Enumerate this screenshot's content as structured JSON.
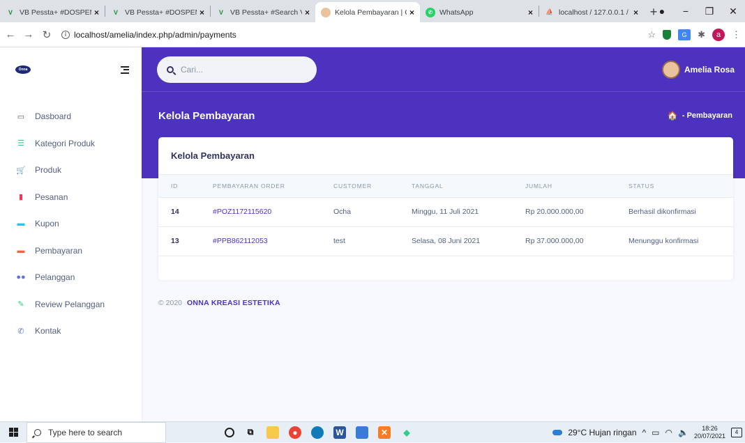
{
  "browser": {
    "tabs": [
      {
        "title": "VB Pessta+ #DOSPEM",
        "active": false
      },
      {
        "title": "VB Pessta+ #DOSPEM",
        "active": false
      },
      {
        "title": "VB Pessta+ #Search V",
        "active": false
      },
      {
        "title": "Kelola Pembayaran | O",
        "active": true
      },
      {
        "title": "WhatsApp",
        "active": false
      },
      {
        "title": "localhost / 127.0.0.1 /",
        "active": false
      }
    ],
    "url": "localhost/amelia/index.php/admin/payments",
    "avatar_letter": "a"
  },
  "sidebar": {
    "logo_text": "Onna",
    "items": [
      {
        "label": "Dasboard",
        "icon": "monitor-icon",
        "color": "#525f7f"
      },
      {
        "label": "Kategori Produk",
        "icon": "list-icon",
        "color": "#2dce89"
      },
      {
        "label": "Produk",
        "icon": "cart-icon",
        "color": "#2dce89"
      },
      {
        "label": "Pesanan",
        "icon": "document-icon",
        "color": "#f5365c"
      },
      {
        "label": "Kupon",
        "icon": "ticket-icon",
        "color": "#11cdef"
      },
      {
        "label": "Pembayaran",
        "icon": "money-icon",
        "color": "#fb6340"
      },
      {
        "label": "Pelanggan",
        "icon": "users-icon",
        "color": "#5e72e4"
      },
      {
        "label": "Review Pelanggan",
        "icon": "edit-icon",
        "color": "#2dce89"
      },
      {
        "label": "Kontak",
        "icon": "phone-icon",
        "color": "#5e72e4"
      }
    ]
  },
  "header": {
    "search_placeholder": "Cari...",
    "user_name": "Amelia Rosa"
  },
  "page": {
    "title": "Kelola Pembayaran",
    "breadcrumb": "- Pembayaran"
  },
  "card": {
    "title": "Kelola Pembayaran",
    "columns": [
      "ID",
      "PEMBAYARAN ORDER",
      "CUSTOMER",
      "TANGGAL",
      "JUMLAH",
      "STATUS"
    ],
    "rows": [
      {
        "id": "14",
        "order": "#POZ1172115620",
        "customer": "Ocha",
        "date": "Minggu, 11 Juli 2021",
        "amount": "Rp 20.000.000,00",
        "status": "Berhasil dikonfirmasi"
      },
      {
        "id": "13",
        "order": "#PPB862112053",
        "customer": "test",
        "date": "Selasa, 08 Juni 2021",
        "amount": "Rp 37.000.000,00",
        "status": "Menunggu konfirmasi"
      }
    ]
  },
  "footer": {
    "copyright": "© 2020",
    "company": "ONNA KREASI ESTETIKA"
  },
  "taskbar": {
    "search_placeholder": "Type here to search",
    "weather": "29°C  Hujan ringan",
    "time": "18:26",
    "date": "20/07/2021",
    "notifications": "4"
  },
  "colors": {
    "primary": "#4c32bf",
    "link": "#4c32bf"
  }
}
